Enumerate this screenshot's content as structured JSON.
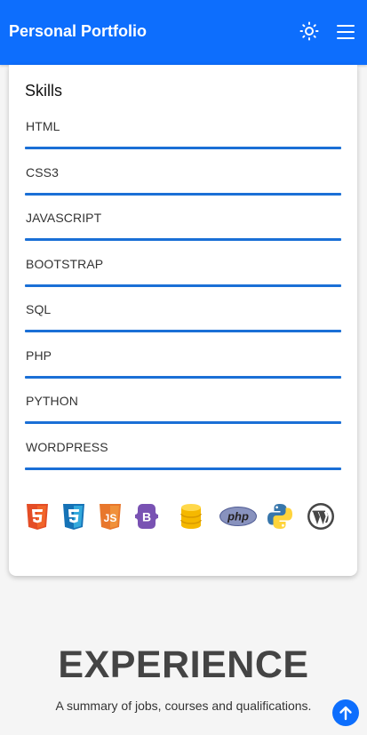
{
  "navbar": {
    "brand": "Personal Portfolio",
    "theme_icon": "sun-icon",
    "menu_icon": "hamburger-menu-icon",
    "background": "#0d6efd"
  },
  "skills": {
    "title": "Skills",
    "bar_color": "#1a6fd6",
    "items": [
      {
        "name": "HTML",
        "level": 1.0
      },
      {
        "name": "CSS3",
        "level": 1.0
      },
      {
        "name": "JAVASCRIPT",
        "level": 1.0
      },
      {
        "name": "BOOTSTRAP",
        "level": 1.0
      },
      {
        "name": "SQL",
        "level": 1.0
      },
      {
        "name": "PHP",
        "level": 1.0
      },
      {
        "name": "PYTHON",
        "level": 1.0
      },
      {
        "name": "WORDPRESS",
        "level": 1.0
      }
    ],
    "icons": [
      "html5-icon",
      "css3-icon",
      "javascript-icon",
      "bootstrap-icon",
      "database-icon",
      "php-icon",
      "python-icon",
      "wordpress-icon"
    ],
    "icon_labels": {
      "js": "JS",
      "bootstrap": "B",
      "php": "php"
    }
  },
  "experience": {
    "title": "EXPERIENCE",
    "subtitle": "A summary of jobs, courses and qualifications."
  },
  "scroll_top_icon": "arrow-up-icon"
}
